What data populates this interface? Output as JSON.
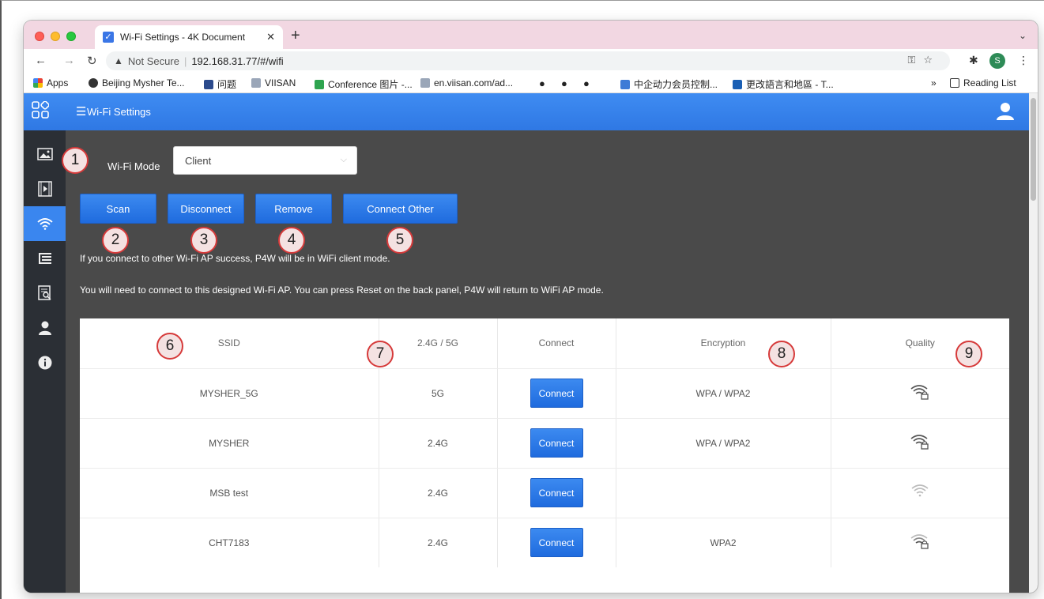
{
  "browser": {
    "tab_title": "Wi-Fi Settings - 4K Document",
    "new_tab": "+",
    "address_security": "Not Secure",
    "address_url": "192.168.31.77/#/wifi",
    "profile_initial": "S",
    "bookmarks": [
      "Apps",
      "Beijing Mysher Te...",
      "问题",
      "VIISAN",
      "Conference 图片 -...",
      "en.viisan.com/ad...",
      "中企动力会员控制...",
      "更改語言和地區 - T..."
    ],
    "bookmarks_more": "»",
    "reading_list": "Reading List"
  },
  "app": {
    "header_title": "Wi-Fi Settings",
    "sidebar_icons": [
      "image-icon",
      "video-icon",
      "wifi-icon",
      "list-icon",
      "search-doc-icon",
      "user-icon",
      "info-icon"
    ],
    "wifi_mode_label": "Wi-Fi Mode",
    "wifi_mode_value": "Client",
    "buttons": {
      "scan": "Scan",
      "disconnect": "Disconnect",
      "remove": "Remove",
      "connect_other": "Connect Other"
    },
    "note1": "If you connect to other Wi-Fi AP success, P4W will be in WiFi client mode.",
    "note2": "You will need to connect to this designed Wi-Fi AP. You can press Reset on the back panel, P4W will return to WiFi AP mode.",
    "table": {
      "headers": [
        "SSID",
        "2.4G / 5G",
        "Connect",
        "Encryption",
        "Quality"
      ],
      "rows": [
        {
          "ssid": "MYSHER_5G",
          "band": "5G",
          "connect": "Connect",
          "encryption": "WPA / WPA2"
        },
        {
          "ssid": "MYSHER",
          "band": "2.4G",
          "connect": "Connect",
          "encryption": "WPA / WPA2"
        },
        {
          "ssid": "MSB test",
          "band": "2.4G",
          "connect": "Connect",
          "encryption": ""
        },
        {
          "ssid": "CHT7183",
          "band": "2.4G",
          "connect": "Connect",
          "encryption": "WPA2"
        }
      ]
    },
    "callouts": [
      "1",
      "2",
      "3",
      "4",
      "5",
      "6",
      "7",
      "8",
      "9"
    ]
  },
  "colors": {
    "accent": "#2f78e4",
    "sidebar": "#2b2f35",
    "content_bg": "#4a4a4a",
    "callout_border": "#d63a3a"
  }
}
